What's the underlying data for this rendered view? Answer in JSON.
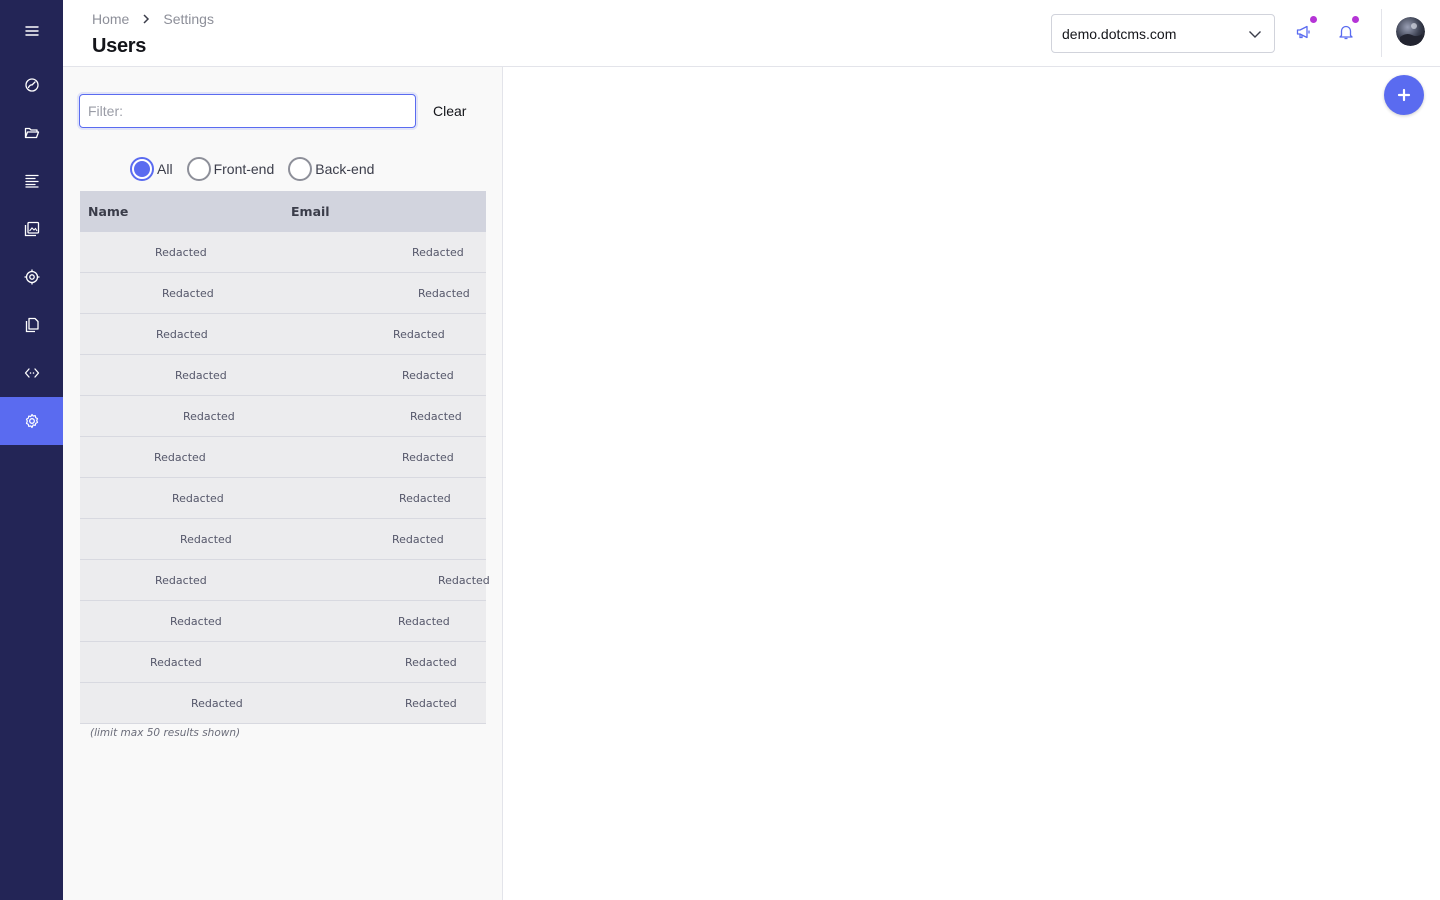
{
  "sidebar": {
    "items": [
      {
        "icon": "menu-icon"
      },
      {
        "icon": "dashboard-icon"
      },
      {
        "icon": "folder-icon"
      },
      {
        "icon": "content-icon"
      },
      {
        "icon": "media-icon"
      },
      {
        "icon": "marketing-icon"
      },
      {
        "icon": "pages-icon"
      },
      {
        "icon": "dev-tools-icon"
      },
      {
        "icon": "settings-icon",
        "active": true
      }
    ]
  },
  "header": {
    "breadcrumb": {
      "home": "Home",
      "current": "Settings"
    },
    "title": "Users",
    "site_selector": "demo.dotcms.com",
    "announcements_icon": "megaphone-icon",
    "notifications_icon": "bell-icon",
    "accent_dot_color": "#b534d6"
  },
  "filter": {
    "placeholder": "Filter:",
    "value": "",
    "clear_label": "Clear"
  },
  "user_type": {
    "options": [
      {
        "label": "All",
        "checked": true
      },
      {
        "label": "Front-end",
        "checked": false
      },
      {
        "label": "Back-end",
        "checked": false
      }
    ]
  },
  "table": {
    "columns": [
      "Name",
      "Email"
    ],
    "rows": [
      {
        "name": "Redacted",
        "email": "Redacted"
      },
      {
        "name": "Redacted",
        "email": "Redacted"
      },
      {
        "name": "Redacted",
        "email": "Redacted"
      },
      {
        "name": "Redacted",
        "email": "Redacted"
      },
      {
        "name": "Redacted",
        "email": "Redacted"
      },
      {
        "name": "Redacted",
        "email": "Redacted"
      },
      {
        "name": "Redacted",
        "email": "Redacted"
      },
      {
        "name": "Redacted",
        "email": "Redacted"
      },
      {
        "name": "Redacted",
        "email": "Redacted"
      },
      {
        "name": "Redacted",
        "email": "Redacted"
      },
      {
        "name": "Redacted",
        "email": "Redacted"
      },
      {
        "name": "Redacted",
        "email": "Redacted"
      }
    ],
    "limit_note": "(limit max 50 results shown)"
  },
  "colors": {
    "sidebar_bg": "#232556",
    "accent": "#5a6bf0"
  }
}
